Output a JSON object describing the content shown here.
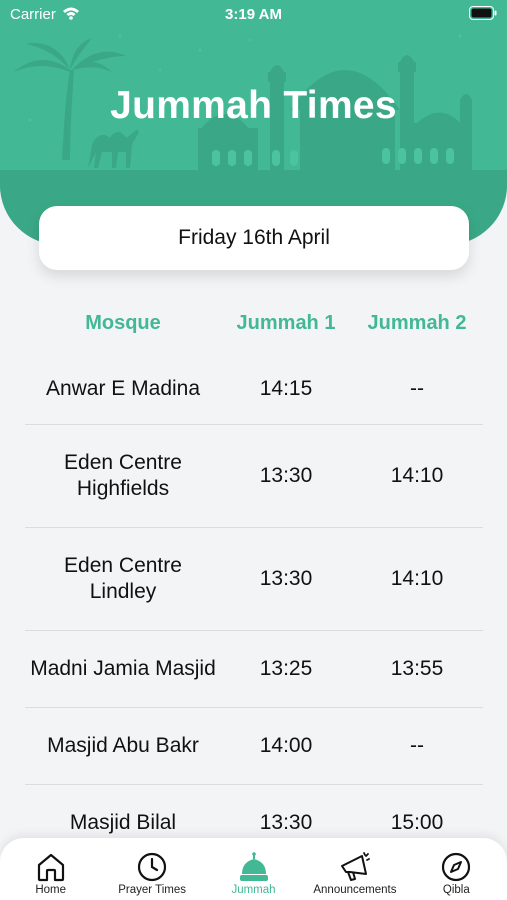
{
  "status": {
    "carrier": "Carrier",
    "time": "3:19 AM"
  },
  "header": {
    "title": "Jummah Times"
  },
  "date": "Friday 16th April",
  "table": {
    "headers": [
      "Mosque",
      "Jummah 1",
      "Jummah 2"
    ],
    "rows": [
      {
        "mosque": [
          "Anwar E Madina"
        ],
        "jummah1": "14:15",
        "jummah2": "--"
      },
      {
        "mosque": [
          "Eden Centre",
          "Highfields"
        ],
        "jummah1": "13:30",
        "jummah2": "14:10"
      },
      {
        "mosque": [
          "Eden Centre",
          "Lindley"
        ],
        "jummah1": "13:30",
        "jummah2": "14:10"
      },
      {
        "mosque": [
          "Madni Jamia Masjid"
        ],
        "jummah1": "13:25",
        "jummah2": "13:55"
      },
      {
        "mosque": [
          "Masjid Abu Bakr"
        ],
        "jummah1": "14:00",
        "jummah2": "--"
      },
      {
        "mosque": [
          "Masjid Bilal"
        ],
        "jummah1": "13:30",
        "jummah2": "15:00"
      }
    ]
  },
  "tabs": [
    {
      "label": "Home",
      "icon": "home-icon",
      "active": false
    },
    {
      "label": "Prayer Times",
      "icon": "clock-icon",
      "active": false
    },
    {
      "label": "Jummah",
      "icon": "mosque-icon",
      "active": true
    },
    {
      "label": "Announcements",
      "icon": "megaphone-icon",
      "active": false
    },
    {
      "label": "Qibla",
      "icon": "compass-icon",
      "active": false
    }
  ],
  "colors": {
    "accent": "#42b894",
    "background": "#f3f4f6"
  }
}
